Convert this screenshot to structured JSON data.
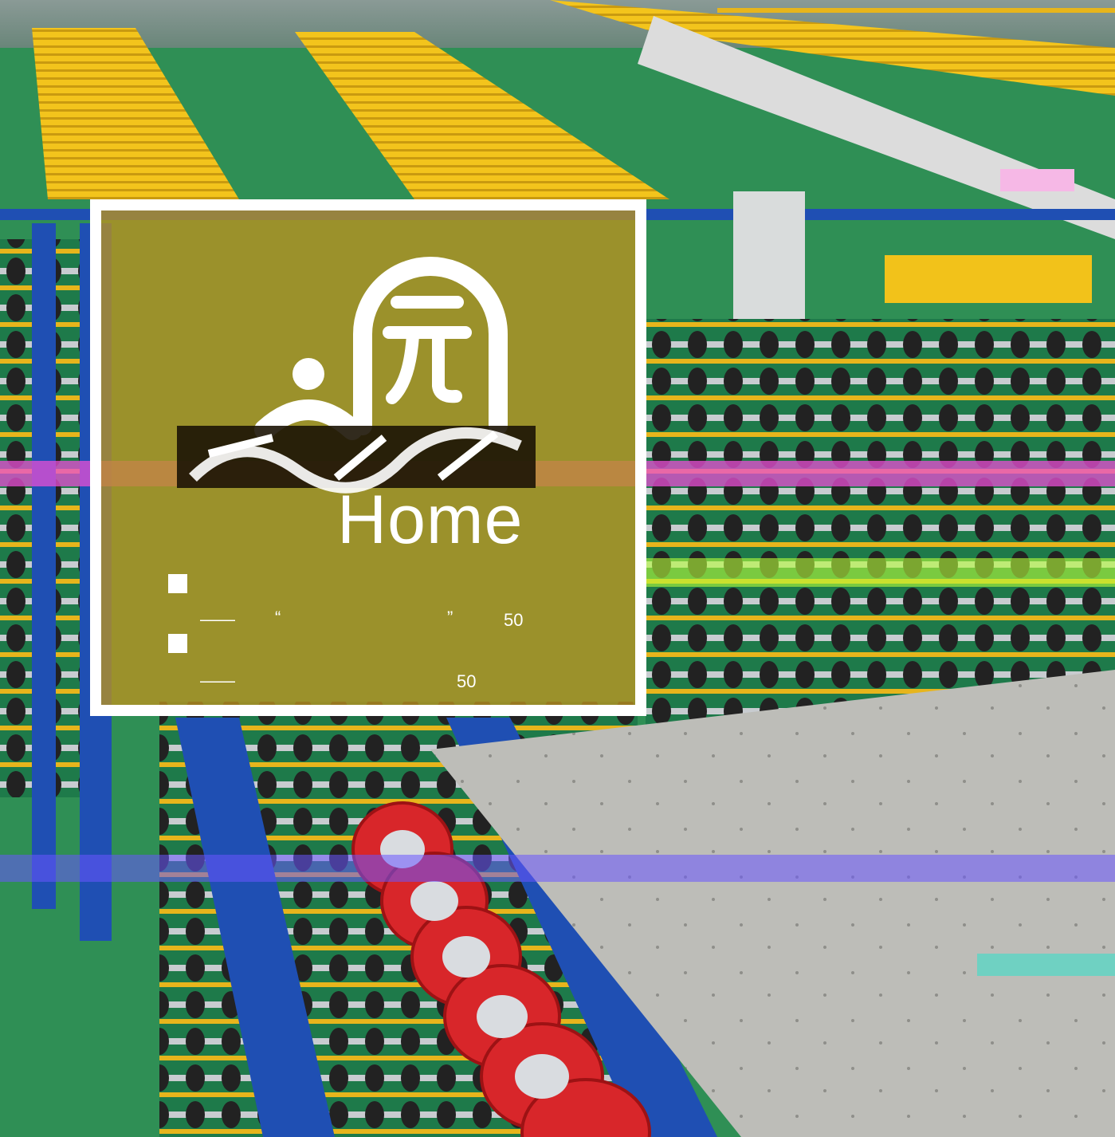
{
  "title": "Home",
  "items": [
    {
      "dash": "——",
      "open_quote": "“",
      "close_quote": "”",
      "value": "50"
    },
    {
      "dash": "——",
      "value": "50"
    }
  ],
  "colors": {
    "panel_overlay": "#ba9220",
    "panel_border": "#ffffff",
    "floor": "#2f8f55",
    "conveyor_yellow": "#f2c21a",
    "frame_blue": "#1f4fb3",
    "roller_red": "#d8262a",
    "board_gray": "#bdbdb8"
  }
}
